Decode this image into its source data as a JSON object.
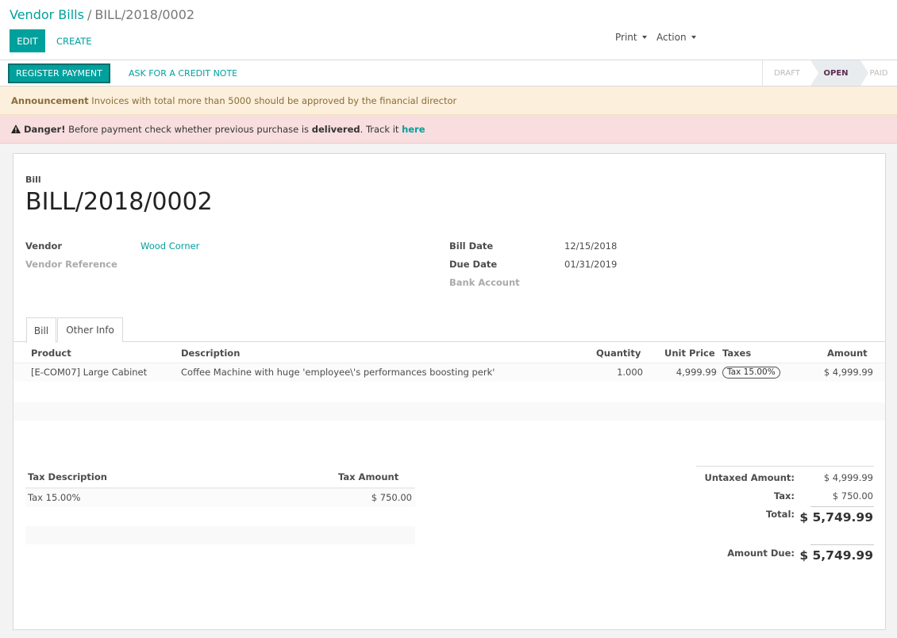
{
  "breadcrumb": {
    "parent": "Vendor Bills",
    "separator": "/",
    "current": "BILL/2018/0002"
  },
  "buttons": {
    "edit": "EDIT",
    "create": "CREATE",
    "print": "Print",
    "action": "Action"
  },
  "statusbar": {
    "register_payment": "REGISTER PAYMENT",
    "credit_note": "ASK FOR A CREDIT NOTE",
    "stages": [
      "DRAFT",
      "OPEN",
      "PAID"
    ],
    "active_stage": "OPEN"
  },
  "alerts": {
    "announcement": {
      "title": "Announcement",
      "text": "Invoices with total more than 5000 should be approved by the financial director"
    },
    "danger": {
      "title": "Danger!",
      "text_before": "Before payment check whether previous purchase is",
      "emphasis": "delivered",
      "text_after": ". Track it",
      "link": "here"
    }
  },
  "form": {
    "doc_label": "Bill",
    "title": "BILL/2018/0002",
    "vendor_label": "Vendor",
    "vendor_value": "Wood Corner",
    "vendor_ref_label": "Vendor Reference",
    "bill_date_label": "Bill Date",
    "bill_date_value": "12/15/2018",
    "due_date_label": "Due Date",
    "due_date_value": "01/31/2019",
    "bank_account_label": "Bank Account"
  },
  "tabs": [
    "Bill",
    "Other Info"
  ],
  "lines": {
    "headers": {
      "product": "Product",
      "description": "Description",
      "quantity": "Quantity",
      "unit_price": "Unit Price",
      "taxes": "Taxes",
      "amount": "Amount"
    },
    "rows": [
      {
        "product": "[E-COM07] Large Cabinet",
        "description": "Coffee Machine with huge 'employee\\'s performances boosting perk'",
        "quantity": "1.000",
        "unit_price": "4,999.99",
        "tax": "Tax 15.00%",
        "amount": "$ 4,999.99"
      }
    ]
  },
  "tax_table": {
    "headers": {
      "description": "Tax Description",
      "amount": "Tax Amount"
    },
    "rows": [
      {
        "description": "Tax 15.00%",
        "amount": "$ 750.00"
      }
    ]
  },
  "totals": {
    "untaxed_label": "Untaxed Amount:",
    "untaxed_value": "$ 4,999.99",
    "tax_label": "Tax:",
    "tax_value": "$ 750.00",
    "total_label": "Total:",
    "total_value": "$ 5,749.99",
    "due_label": "Amount Due:",
    "due_value": "$ 5,749.99"
  },
  "colors": {
    "primary": "#00a09d",
    "warning_bg": "#fcefdc",
    "danger_bg": "#f8dedf",
    "active_stage": "#5c2d4f"
  }
}
